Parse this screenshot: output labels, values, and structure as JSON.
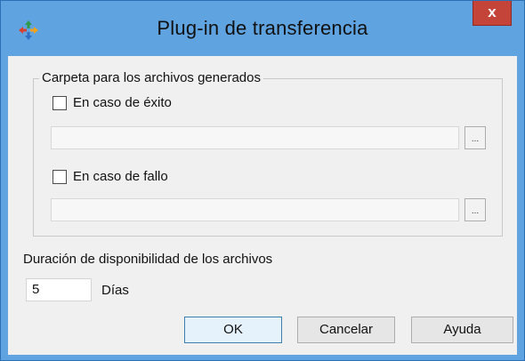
{
  "window": {
    "title": "Plug-in de transferencia",
    "close_label": "x",
    "app_icon": "transfer-arrows-icon"
  },
  "group": {
    "legend": "Carpeta para los archivos generados",
    "success": {
      "checkbox_label": "En caso de éxito",
      "checked": false,
      "path_value": "",
      "browse_label": "..."
    },
    "failure": {
      "checkbox_label": "En caso de fallo",
      "checked": false,
      "path_value": "",
      "browse_label": "..."
    }
  },
  "availability": {
    "label": "Duración de disponibilidad de los archivos",
    "value": "5",
    "unit_label": "Días"
  },
  "buttons": {
    "ok": "OK",
    "cancel": "Cancelar",
    "help": "Ayuda"
  },
  "colors": {
    "titlebar": "#5fa3e0",
    "close_button": "#c5443a",
    "client": "#f0f0f0"
  }
}
